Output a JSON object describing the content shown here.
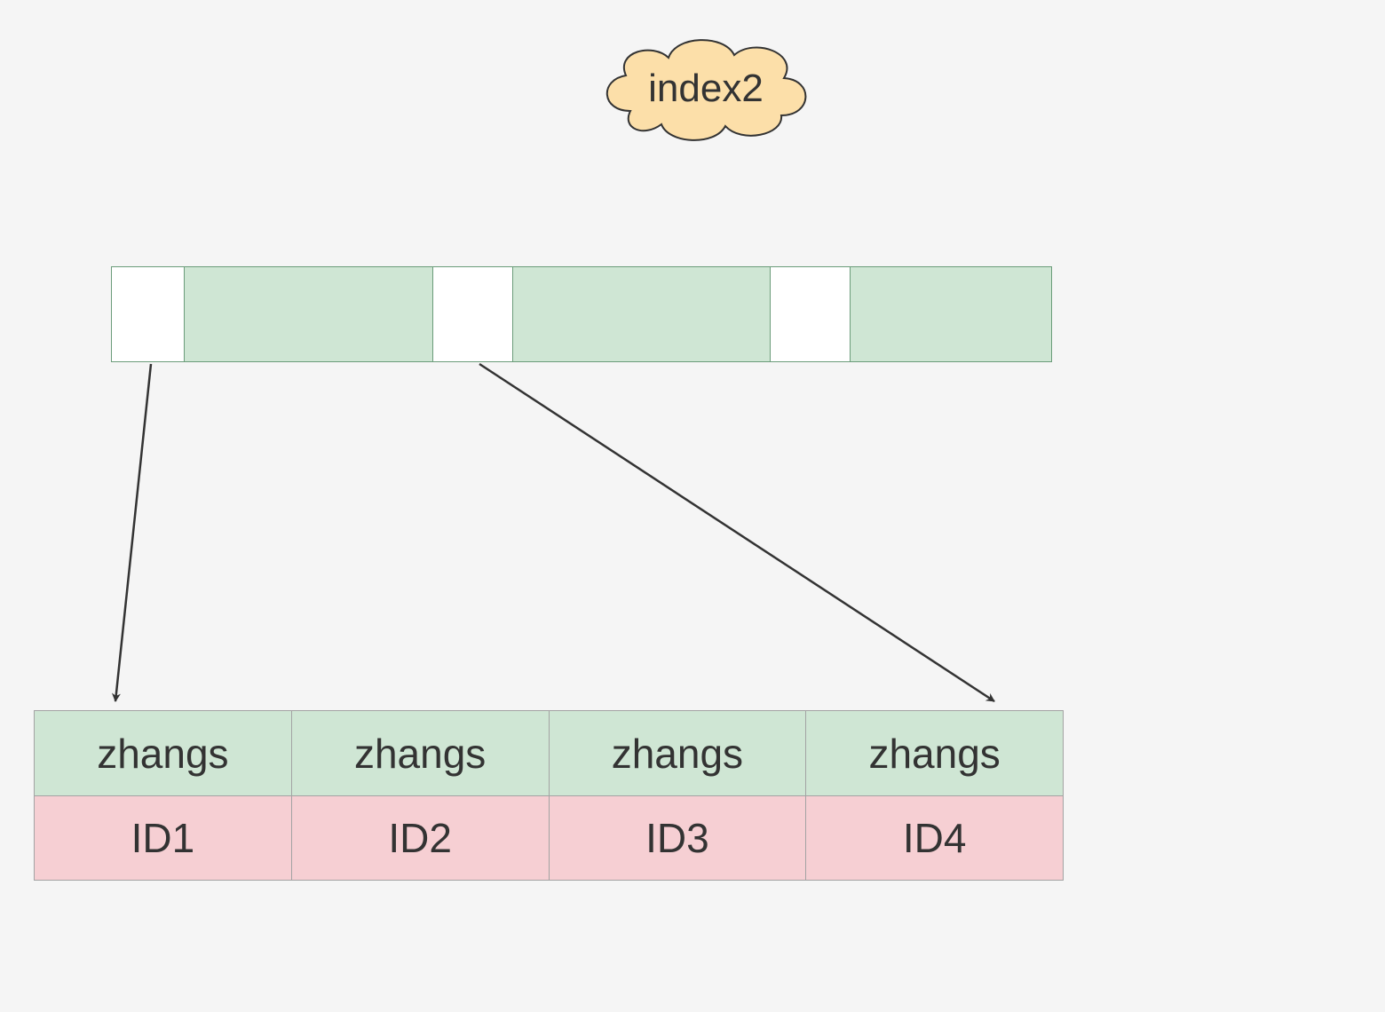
{
  "cloud": {
    "label": "index2"
  },
  "leaf": {
    "names": [
      "zhangs",
      "zhangs",
      "zhangs",
      "zhangs"
    ],
    "ids": [
      "ID1",
      "ID2",
      "ID3",
      "ID4"
    ]
  },
  "colors": {
    "background": "#f5f5f5",
    "cloud_fill": "#fcdfa9",
    "cloud_stroke": "#333333",
    "green_fill": "#cfe6d4",
    "green_stroke": "#6b9c7a",
    "pink_fill": "#f6cfd3",
    "table_stroke": "#a3a3a3",
    "arrow": "#333333"
  }
}
